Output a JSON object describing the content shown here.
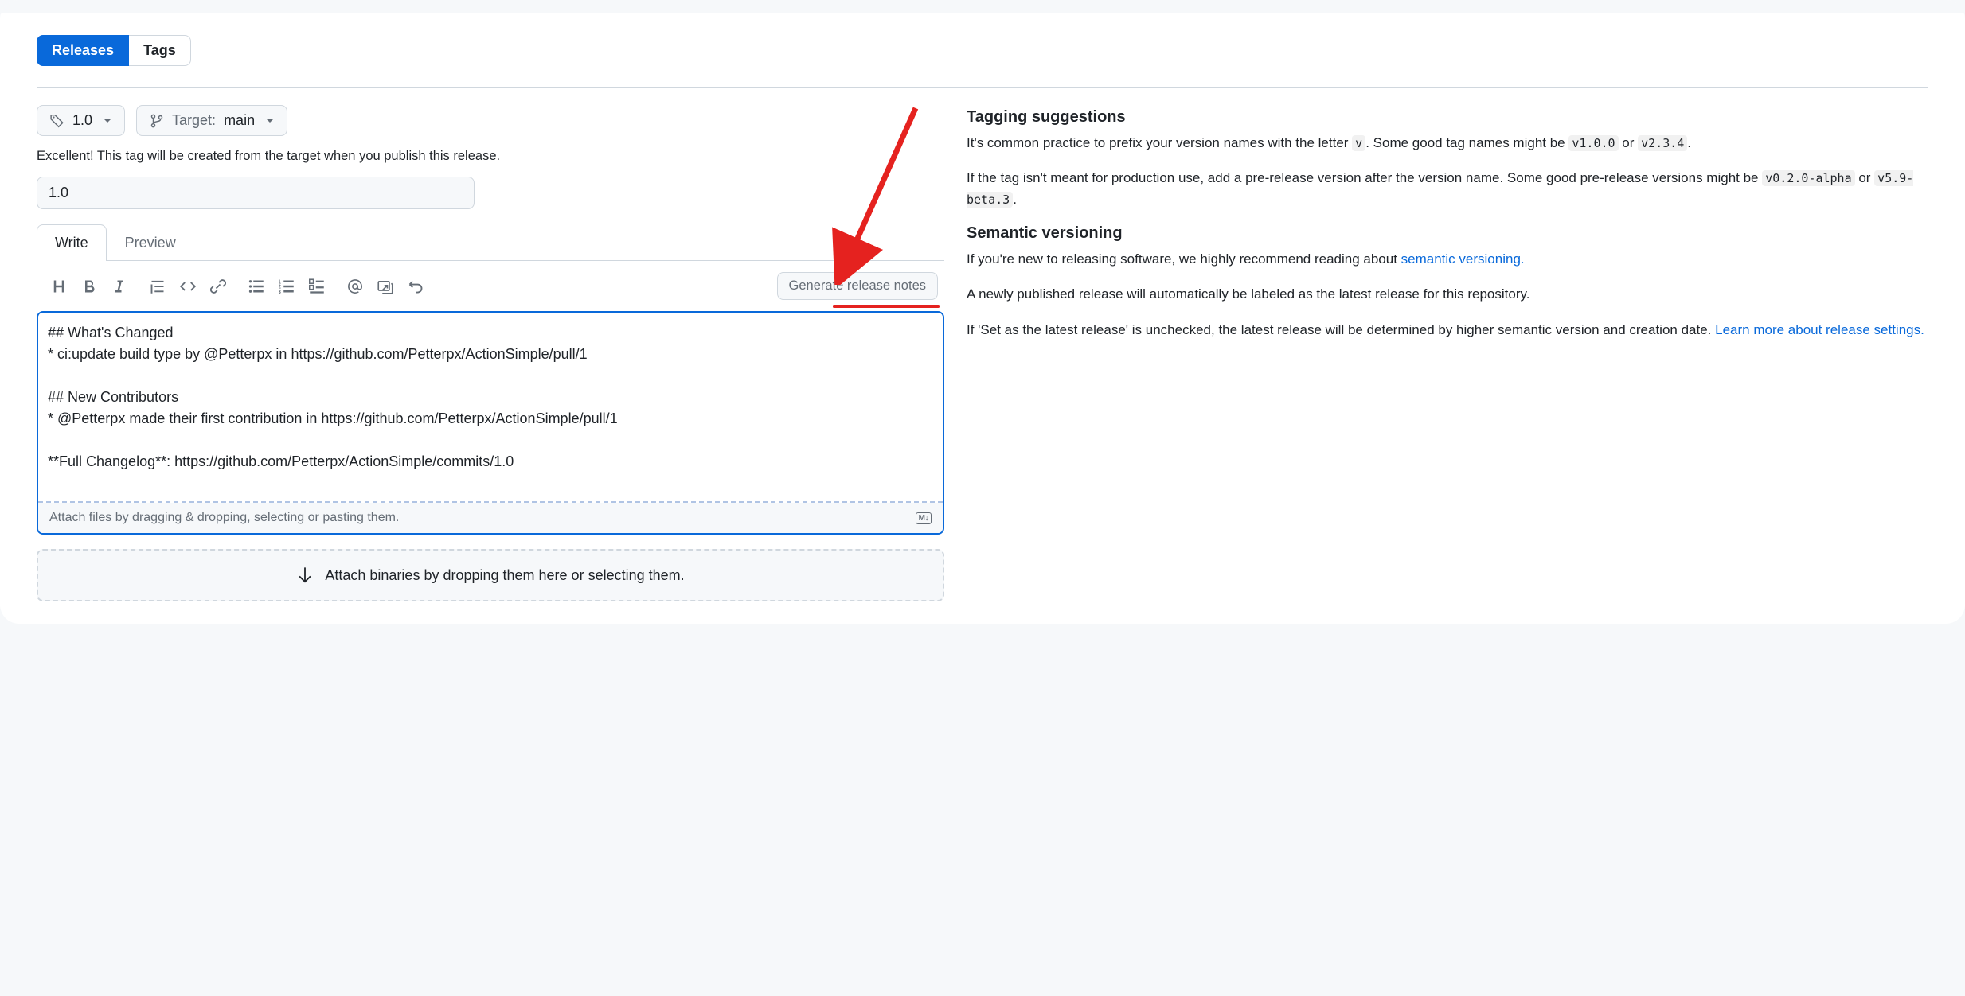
{
  "nav": {
    "releases": "Releases",
    "tags": "Tags"
  },
  "tagSelector": {
    "tag": "1.0",
    "targetLabel": "Target:",
    "targetBranch": "main"
  },
  "helpText": "Excellent! This tag will be created from the target when you publish this release.",
  "titleValue": "1.0",
  "editorTabs": {
    "write": "Write",
    "preview": "Preview"
  },
  "generateButton": "Generate release notes",
  "editorContent": "## What's Changed\n* ci:update build type by @Petterpx in https://github.com/Petterpx/ActionSimple/pull/1\n\n## New Contributors\n* @Petterpx made their first contribution in https://github.com/Petterpx/ActionSimple/pull/1\n\n**Full Changelog**: https://github.com/Petterpx/ActionSimple/commits/1.0",
  "attachHint": "Attach files by dragging & dropping, selecting or pasting them.",
  "markdownBadge": "M↓",
  "binaryDrop": "Attach binaries by dropping them here or selecting them.",
  "sidebar": {
    "heading1": "Tagging suggestions",
    "p1a": "It's common practice to prefix your version names with the letter ",
    "p1code1": "v",
    "p1b": ". Some good tag names might be ",
    "p1code2": "v1.0.0",
    "p1c": " or ",
    "p1code3": "v2.3.4",
    "p1d": ".",
    "p2a": "If the tag isn't meant for production use, add a pre-release version after the version name. Some good pre-release versions might be ",
    "p2code1": "v0.2.0-alpha",
    "p2b": " or ",
    "p2code2": "v5.9-beta.3",
    "p2c": ".",
    "heading2": "Semantic versioning",
    "p3a": "If you're new to releasing software, we highly recommend reading about ",
    "p3link": "semantic versioning.",
    "p4": "A newly published release will automatically be labeled as the latest release for this repository.",
    "p5a": "If 'Set as the latest release' is unchecked, the latest release will be determined by higher semantic version and creation date. ",
    "p5link": "Learn more about release settings."
  }
}
